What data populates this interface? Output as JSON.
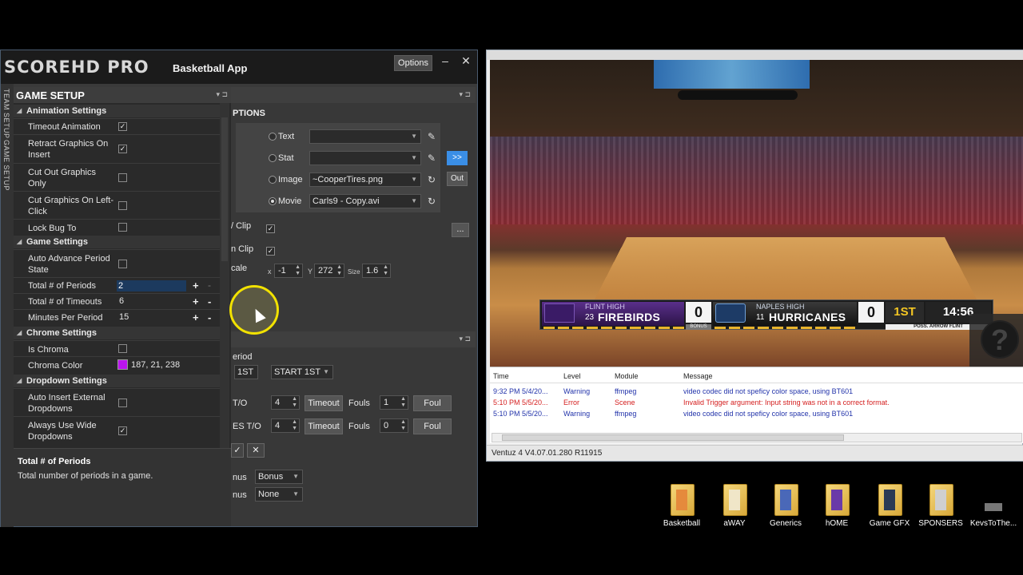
{
  "app": {
    "brand": "SCOREHD PRO",
    "subtitle": "Basketball App",
    "options_button": "Options",
    "minimize": "–",
    "close": "✕"
  },
  "vtabs": [
    "TEAM SETUP",
    "GAME SETUP"
  ],
  "game_setup": {
    "title": "GAME SETUP",
    "categories": [
      {
        "name": "Animation Settings"
      },
      {
        "name": "Game Settings"
      },
      {
        "name": "Chrome Settings"
      },
      {
        "name": "Dropdown Settings"
      }
    ],
    "props": {
      "timeout_animation": {
        "label": "Timeout Animation",
        "checked": "✓"
      },
      "retract_graphics": {
        "label": "Retract Graphics On Insert",
        "checked": "✓"
      },
      "cut_out_graphics": {
        "label": "Cut Out Graphics Only",
        "checked": ""
      },
      "cut_graphics_left": {
        "label": "Cut Graphics On Left-Click",
        "checked": ""
      },
      "lock_bug": {
        "label": "Lock Bug To Scorebar",
        "checked": ""
      },
      "auto_advance": {
        "label": "Auto Advance Period State",
        "checked": ""
      },
      "total_periods": {
        "label": "Total # of Periods",
        "value": "2"
      },
      "total_timeouts": {
        "label": "Total # of Timeouts",
        "value": "6"
      },
      "minutes_per_period": {
        "label": "Minutes Per Period",
        "value": "15"
      },
      "is_chroma": {
        "label": "Is Chroma",
        "checked": ""
      },
      "chroma_color": {
        "label": "Chroma Color",
        "value": "187, 21, 238",
        "color": "#bb15ee"
      },
      "auto_insert_external": {
        "label": "Auto Insert External Dropdowns",
        "checked": ""
      },
      "always_wide": {
        "label": "Always Use Wide Dropdowns",
        "checked": "✓"
      }
    },
    "plus": "+",
    "minus": "-",
    "description": {
      "title": "Total # of Periods",
      "text": "Total number of periods in a game."
    }
  },
  "bg_panel": {
    "section_options": "PTIONS",
    "media": [
      {
        "label": "Text",
        "value": ""
      },
      {
        "label": "Stat",
        "value": ""
      },
      {
        "label": "Image",
        "value": "~CooperTires.png"
      },
      {
        "label": "Movie",
        "value": "Carls9 - Copy.avi"
      }
    ],
    "go_button": ">>",
    "out_button": "Out",
    "row_clip1": "/ Clip",
    "row_clip2": "n Clip",
    "row_scale": "cale",
    "ellipsis_button": "...",
    "x_label": "x",
    "x_value": "-1",
    "y_label": "Y",
    "y_value": "272",
    "size_label": "Size",
    "size_value": "1.6",
    "period_label": "eriod",
    "period_value": "1ST",
    "period_start": "START 1ST",
    "to1_label": "T/O",
    "to1_value": "4",
    "to2_label": "ES T/O",
    "to2_value": "4",
    "timeout_button": "Timeout",
    "fouls_label": "Fouls",
    "fouls1": "1",
    "fouls2": "0",
    "foul_button": "Foul",
    "confirm": "✓",
    "cancel": "✕",
    "bonus1_label": "nus",
    "bonus1_value": "Bonus",
    "bonus2_label": "nus",
    "bonus2_value": "None"
  },
  "scoreboard": {
    "team1_school": "FLINT HIGH",
    "team1_seed": "23",
    "team1_name": "FIREBIRDS",
    "team1_score": "0",
    "team2_school": "NAPLES HIGH",
    "team2_seed": "11",
    "team2_name": "HURRICANES",
    "team2_score": "0",
    "period": "1ST",
    "clock": "14:56",
    "bonus": "BONUS",
    "poss": "POSS. ARROW FLINT"
  },
  "log": {
    "columns": [
      "Time",
      "Level",
      "Module",
      "Message"
    ],
    "rows": [
      {
        "time": "9:32 PM 5/4/20...",
        "level": "Warning",
        "module": "ffmpeg",
        "message": "video codec did not speficy color space, using BT601",
        "kind": "warn"
      },
      {
        "time": "5:10 PM 5/5/20...",
        "level": "Error",
        "module": "Scene",
        "message": "Invalid Trigger argument: Input string was not in a correct format.",
        "kind": "err"
      },
      {
        "time": "5:10 PM 5/5/20...",
        "level": "Warning",
        "module": "ffmpeg",
        "message": "video codec did not speficy color space, using BT601",
        "kind": "warn"
      }
    ]
  },
  "status": "Ventuz 4 V4.07.01.280 R11915",
  "desktop": [
    "Basketball",
    "aWAY",
    "Generics",
    "hOME",
    "Game GFX",
    "SPONSERS",
    "KevsToThe..."
  ]
}
